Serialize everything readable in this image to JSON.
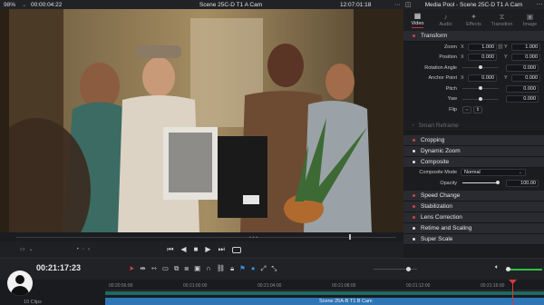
{
  "top_bar": {
    "zoom": "98%",
    "timecode": "00:00:04:22",
    "clip_name": "Scene 25C-D T1 A Cam",
    "record_tc": "12:07:01:18"
  },
  "inspector": {
    "header_title": "Media Pool - Scene 25C-D T1 A Cam",
    "tabs": [
      {
        "label": "Video",
        "icon": "film-icon",
        "active": true
      },
      {
        "label": "Audio",
        "icon": "music-note-icon",
        "active": false
      },
      {
        "label": "Effects",
        "icon": "effects-icon",
        "active": false
      },
      {
        "label": "Transition",
        "icon": "transition-icon",
        "active": false
      },
      {
        "label": "Image",
        "icon": "image-icon",
        "active": false
      }
    ],
    "transform": {
      "title": "Transform",
      "zoom_label": "Zoom",
      "zoom_x": "1.000",
      "zoom_y": "1.000",
      "position_label": "Position",
      "position_x": "0.000",
      "position_y": "0.000",
      "rotation_label": "Rotation Angle",
      "rotation": "0.000",
      "anchor_label": "Anchor Point",
      "anchor_x": "0.000",
      "anchor_y": "0.000",
      "pitch_label": "Pitch",
      "pitch": "0.000",
      "yaw_label": "Yaw",
      "yaw": "0.000",
      "flip_label": "Flip",
      "x_label": "X",
      "y_label": "Y"
    },
    "smart_reframe": "Smart Reframe",
    "cropping": "Cropping",
    "dynamic_zoom": "Dynamic Zoom",
    "composite": {
      "title": "Composite",
      "mode_label": "Composite Mode",
      "mode_value": "Normal",
      "opacity_label": "Opacity",
      "opacity_value": "100.00"
    },
    "speed_change": "Speed Change",
    "stabilization": "Stabilization",
    "lens_correction": "Lens Correction",
    "retime_scaling": "Retime and Scaling",
    "super_scale": "Super Scale"
  },
  "timeline": {
    "timecode": "00:21:17:23",
    "clip_count": "10 Clips",
    "ruler": [
      "00:20:56:00",
      "00:21:00:00",
      "00:21:04:00",
      "00:21:08:00",
      "00:21:12:00",
      "00:21:16:00"
    ],
    "clip_label": "Scene 25A-B T1 B Cam"
  },
  "colors": {
    "accent_red": "#d04545",
    "clip_blue": "#2f76b6",
    "range_teal": "#1e6b62",
    "volume_green": "#2fbf45"
  }
}
